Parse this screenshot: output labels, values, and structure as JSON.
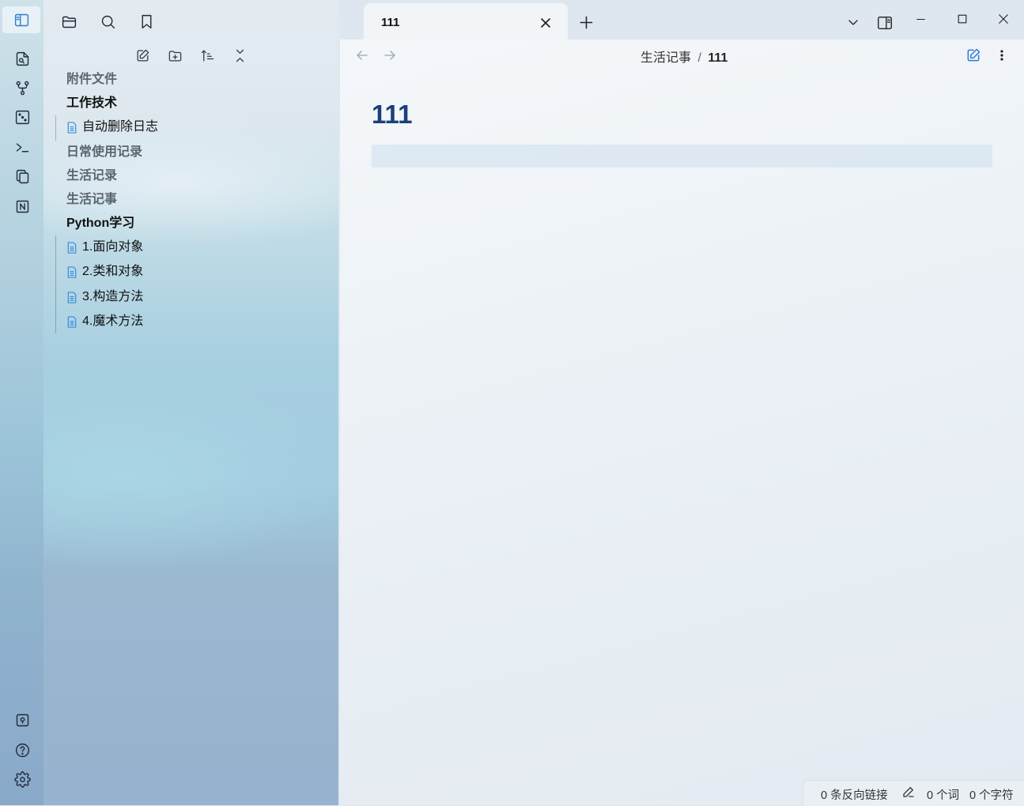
{
  "ribbon": {
    "icons": [
      "toggle-sidebar-icon",
      "open-quick-switcher-icon",
      "graph-view-icon",
      "canvas-icon",
      "terminal-icon",
      "templates-icon",
      "notion-icon"
    ],
    "bottom_icons": [
      "vault-switch-icon",
      "help-icon",
      "settings-icon"
    ]
  },
  "sidebar": {
    "top_tabs": [
      "files-tab",
      "search-tab",
      "bookmarks-tab"
    ],
    "actions": [
      "new-note",
      "new-folder",
      "sort",
      "collapse-all"
    ],
    "tree": {
      "folder_1": "附件文件",
      "folder_2": "工作技术",
      "file_2_1": "自动删除日志",
      "folder_3": "日常使用记录",
      "folder_4": "生活记录",
      "folder_5": "生活记事",
      "folder_6": "Python学习",
      "file_6_1": "1.面向对象",
      "file_6_2": "2.类和对象",
      "file_6_3": "3.构造方法",
      "file_6_4": "4.魔术方法"
    }
  },
  "tabs": {
    "active_title": "111"
  },
  "header": {
    "breadcrumb_folder": "生活记事",
    "breadcrumb_sep": "/",
    "breadcrumb_current": "111"
  },
  "note": {
    "title": "111"
  },
  "status": {
    "backlinks": "0 条反向链接",
    "words": "0 个词",
    "chars": "0 个字符"
  },
  "colors": {
    "accent": "#2e7bd4",
    "title": "#1c3f7a"
  }
}
